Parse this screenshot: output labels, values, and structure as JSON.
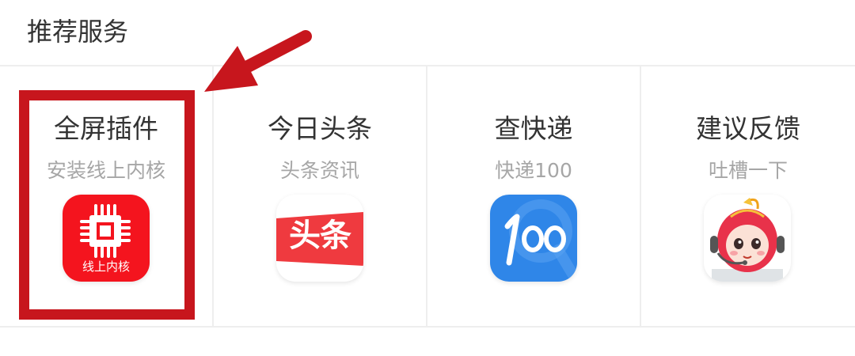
{
  "header": {
    "title": "推荐服务"
  },
  "services": [
    {
      "title": "全屏插件",
      "subtitle": "安装线上内核",
      "icon_name": "chip-icon",
      "icon_label": "线上内核",
      "color": "#f4141e"
    },
    {
      "title": "今日头条",
      "subtitle": "头条资讯",
      "icon_name": "toutiao-icon",
      "icon_label": "头条",
      "color": "#ef3a3f"
    },
    {
      "title": "查快递",
      "subtitle": "快递100",
      "icon_name": "kuaidi100-icon",
      "icon_label": "100",
      "color": "#2f86e8"
    },
    {
      "title": "建议反馈",
      "subtitle": "吐槽一下",
      "icon_name": "feedback-mascot-icon",
      "color": "#e8324a"
    }
  ],
  "annotation": {
    "color": "#c7161d",
    "highlighted_item": "全屏插件"
  }
}
